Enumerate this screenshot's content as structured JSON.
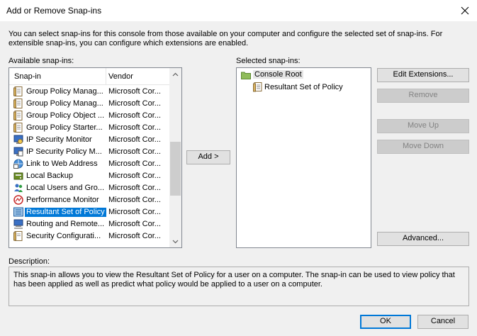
{
  "window": {
    "title": "Add or Remove Snap-ins"
  },
  "intro_text": "You can select snap-ins for this console from those available on your computer and configure the selected set of snap-ins. For extensible snap-ins, you can configure which extensions are enabled.",
  "available": {
    "label": "Available snap-ins:",
    "columns": [
      "Snap-in",
      "Vendor"
    ],
    "items": [
      {
        "name": "Group Policy Manag...",
        "vendor": "Microsoft Cor...",
        "icon": "document-icon"
      },
      {
        "name": "Group Policy Manag...",
        "vendor": "Microsoft Cor...",
        "icon": "document-icon"
      },
      {
        "name": "Group Policy Object ...",
        "vendor": "Microsoft Cor...",
        "icon": "document-icon"
      },
      {
        "name": "Group Policy Starter...",
        "vendor": "Microsoft Cor...",
        "icon": "document-icon"
      },
      {
        "name": "IP Security Monitor",
        "vendor": "Microsoft Cor...",
        "icon": "ip-security-monitor-icon"
      },
      {
        "name": "IP Security Policy M...",
        "vendor": "Microsoft Cor...",
        "icon": "ip-security-policy-icon"
      },
      {
        "name": "Link to Web Address",
        "vendor": "Microsoft Cor...",
        "icon": "web-link-icon"
      },
      {
        "name": "Local Backup",
        "vendor": "Microsoft Cor...",
        "icon": "backup-icon"
      },
      {
        "name": "Local Users and Gro...",
        "vendor": "Microsoft Cor...",
        "icon": "users-icon"
      },
      {
        "name": "Performance Monitor",
        "vendor": "Microsoft Cor...",
        "icon": "performance-monitor-icon"
      },
      {
        "name": "Resultant Set of Policy",
        "vendor": "Microsoft Cor...",
        "icon": "rsop-icon",
        "selected": true
      },
      {
        "name": "Routing and Remote...",
        "vendor": "Microsoft Cor...",
        "icon": "routing-icon"
      },
      {
        "name": "Security Configurati...",
        "vendor": "Microsoft Cor...",
        "icon": "security-config-icon"
      }
    ]
  },
  "add_button": "Add >",
  "selected": {
    "label": "Selected snap-ins:",
    "root": "Console Root",
    "children": [
      "Resultant Set of Policy"
    ]
  },
  "side_buttons": {
    "edit_extensions": "Edit Extensions...",
    "remove": "Remove",
    "move_up": "Move Up",
    "move_down": "Move Down",
    "advanced": "Advanced..."
  },
  "description": {
    "label": "Description:",
    "text": "This snap-in allows you to view the Resultant Set of Policy for a user on a computer.  The snap-in can be used to view policy that has been applied as well as predict what policy would be applied to a user on a computer."
  },
  "footer": {
    "ok": "OK",
    "cancel": "Cancel"
  },
  "colors": {
    "selection": "#0078d7",
    "folder": "#8fbc5a"
  }
}
